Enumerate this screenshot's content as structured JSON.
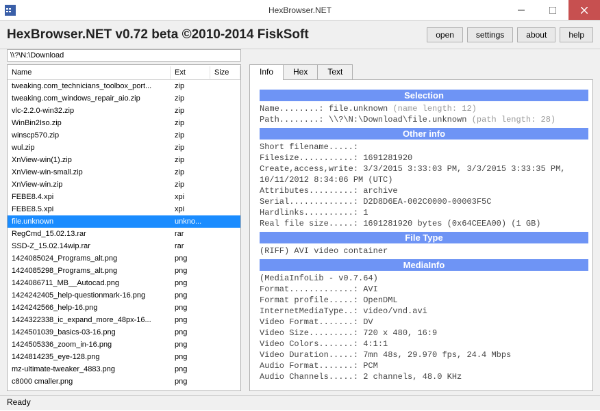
{
  "window": {
    "title": "HexBrowser.NET"
  },
  "header": {
    "title": "HexBrowser.NET v0.72 beta  ©2010-2014 FiskSoft"
  },
  "buttons": {
    "open": "open",
    "settings": "settings",
    "about": "about",
    "help": "help"
  },
  "pathbar": {
    "value": "\\\\?\\N:\\Download"
  },
  "list": {
    "cols": {
      "name": "Name",
      "ext": "Ext",
      "size": "Size"
    },
    "files": [
      {
        "name": "tweaking.com_technicians_toolbox_port...",
        "ext": "zip"
      },
      {
        "name": "tweaking.com_windows_repair_aio.zip",
        "ext": "zip"
      },
      {
        "name": "vlc-2.2.0-win32.zip",
        "ext": "zip"
      },
      {
        "name": "WinBin2Iso.zip",
        "ext": "zip"
      },
      {
        "name": "winscp570.zip",
        "ext": "zip"
      },
      {
        "name": "wul.zip",
        "ext": "zip"
      },
      {
        "name": "XnView-win(1).zip",
        "ext": "zip"
      },
      {
        "name": "XnView-win-small.zip",
        "ext": "zip"
      },
      {
        "name": "XnView-win.zip",
        "ext": "zip"
      },
      {
        "name": "FEBE8.4.xpi",
        "ext": "xpi"
      },
      {
        "name": "FEBE8.5.xpi",
        "ext": "xpi"
      },
      {
        "name": "file.unknown",
        "ext": "unkno...",
        "selected": true
      },
      {
        "name": "RegCmd_15.02.13.rar",
        "ext": "rar"
      },
      {
        "name": "SSD-Z_15.02.14wip.rar",
        "ext": "rar"
      },
      {
        "name": "1424085024_Programs_alt.png",
        "ext": "png"
      },
      {
        "name": "1424085298_Programs_alt.png",
        "ext": "png"
      },
      {
        "name": "1424086711_MB__Autocad.png",
        "ext": "png"
      },
      {
        "name": "1424242405_help-questionmark-16.png",
        "ext": "png"
      },
      {
        "name": "1424242566_help-16.png",
        "ext": "png"
      },
      {
        "name": "1424322338_ic_expand_more_48px-16...",
        "ext": "png"
      },
      {
        "name": "1424501039_basics-03-16.png",
        "ext": "png"
      },
      {
        "name": "1424505336_zoom_in-16.png",
        "ext": "png"
      },
      {
        "name": "1424814235_eye-128.png",
        "ext": "png"
      },
      {
        "name": "mz-ultimate-tweaker_4883.png",
        "ext": "png"
      },
      {
        "name": "c8000 cmaller.png",
        "ext": "png"
      }
    ]
  },
  "tabs": {
    "info": "Info",
    "hex": "Hex",
    "text": "Text",
    "active": "info"
  },
  "info": {
    "selection": {
      "head": "Selection",
      "name_label": "Name........: ",
      "name_val": "file.unknown",
      "name_len": " (name length: 12)",
      "path_label": "Path........: ",
      "path_val": "\\\\?\\N:\\Download\\file.unknown",
      "path_len": " (path length: 28)"
    },
    "other": {
      "head": "Other info",
      "l1": "Short filename.....:",
      "l2": "Filesize...........: 1691281920",
      "l3": "Create,access,write: 3/3/2015 3:33:03 PM, 3/3/2015 3:33:35 PM,",
      "l3b": "10/11/2012 8:34:06 PM (UTC)",
      "l4": "Attributes.........: archive",
      "l5": "Serial.............: D2D8D6EA-002C0000-00003F5C",
      "l6": "Hardlinks..........: 1",
      "l7": "Real file size.....: 1691281920 bytes (0x64CEEA00) (1 GB)"
    },
    "filetype": {
      "head": "File Type",
      "l1": "(RIFF) AVI video container"
    },
    "mediainfo": {
      "head": "MediaInfo",
      "l1": "(MediaInfoLib - v0.7.64)",
      "l2": "Format.............: AVI",
      "l3": "Format profile.....: OpenDML",
      "l4": "InternetMediaType..: video/vnd.avi",
      "l5": "Video Format.......: DV",
      "l6": "Video Size.........: 720 x 480, 16:9",
      "l7": "Video Colors.......: 4:1:1",
      "l8": "Video Duration.....: 7mn 48s, 29.970 fps, 24.4 Mbps",
      "l9": "Audio Format.......: PCM",
      "l10": "Audio Channels.....: 2 channels, 48.0 KHz"
    }
  },
  "status": {
    "text": "Ready"
  }
}
